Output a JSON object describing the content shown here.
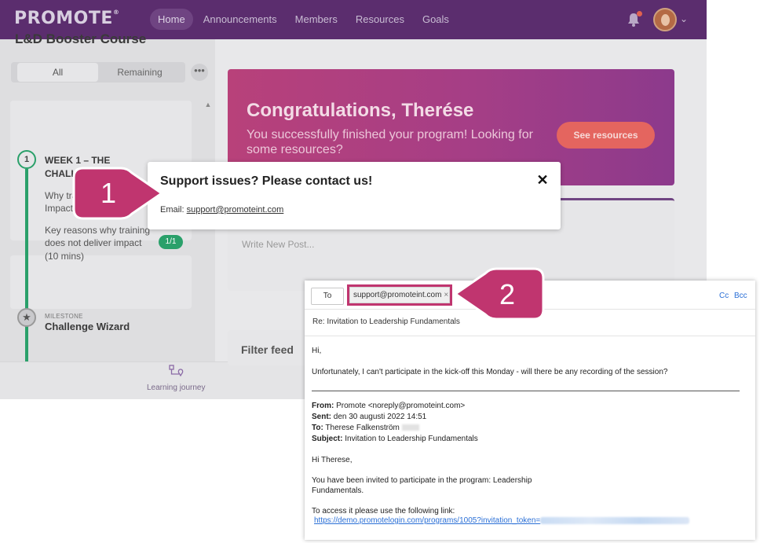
{
  "header": {
    "logo": "PROMOTE",
    "logo_mark": "®",
    "nav": [
      "Home",
      "Announcements",
      "Members",
      "Resources",
      "Goals"
    ]
  },
  "sidebar": {
    "course_title": "L&D Booster Course",
    "filter_all": "All",
    "filter_remaining": "Remaining",
    "more": "•••",
    "step_number": "1",
    "week_title": "WEEK 1 – THE CHALLE",
    "item1_line1": "Why tra",
    "item1_line2": "Impact (",
    "item2_line1": "Key reasons why training",
    "item2_line2": "does not deliver impact",
    "item2_line3": "(10 mins)",
    "item2_badge": "1/1",
    "milestone_label": "MILESTONE",
    "milestone_title": "Challenge Wizard"
  },
  "bottom_nav": {
    "learning_journey": "Learning journey"
  },
  "banner": {
    "title": "Congratulations, Therése",
    "text": "You successfully finished your program! Looking for some resources?",
    "button": "See resources"
  },
  "feed": {
    "post_placeholder": "Write New Post...",
    "filter_title": "Filter feed"
  },
  "modal": {
    "title": "Support issues? Please contact us!",
    "close": "✕",
    "email_label": "Email: ",
    "email": "support@promoteint.com"
  },
  "callouts": {
    "one": "1",
    "two": "2"
  },
  "email": {
    "to_label": "To",
    "recipient": "support@promoteint.com",
    "remove": "×",
    "cc": "Cc",
    "bcc": "Bcc",
    "subject": "Re: Invitation to Leadership Fundamentals",
    "greeting": "Hi,",
    "body": "Unfortunately, I can't participate in the kick-off this Monday - will there be any recording of the session?",
    "from_label": "From:",
    "from": " Promote <noreply@promoteint.com>",
    "sent_label": "Sent:",
    "sent": " den 30 augusti 2022 14:51",
    "to2_label": "To:",
    "to2": " Therese Falkenström",
    "subject_label": "Subject:",
    "subject2": " Invitation to Leadership Fundamentals",
    "quoted_greeting": "Hi Therese,",
    "quoted_line1": "You have been invited to participate in the program: Leadership",
    "quoted_line2": " Fundamentals.",
    "quoted_line3": "To access it please use the following link:",
    "link": "https://demo.promotelogin.com/programs/1005?invitation_token="
  },
  "colors": {
    "topbar": "#5b2d6e",
    "banner": "#b8417a",
    "callout": "#c0356f",
    "success": "#2aa06a",
    "link": "#2a6fd6"
  }
}
